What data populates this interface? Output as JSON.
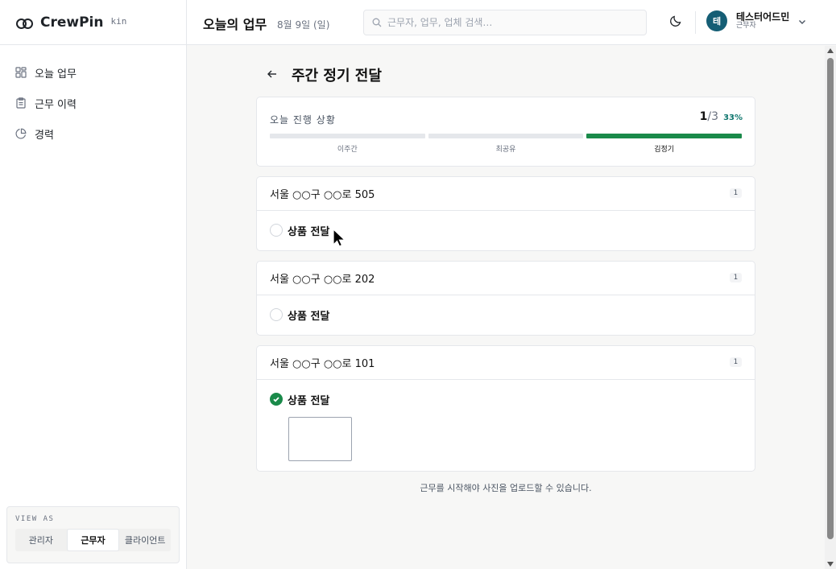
{
  "brand": {
    "name": "CrewPin",
    "sub": "kin"
  },
  "sidebar": {
    "items": [
      {
        "label": "오늘 업무",
        "icon": "grid-icon"
      },
      {
        "label": "근무 이력",
        "icon": "clipboard-icon"
      },
      {
        "label": "경력",
        "icon": "pie-chart-icon"
      }
    ],
    "view_as": {
      "title": "VIEW AS",
      "options": [
        "관리자",
        "근무자",
        "클라이언트"
      ],
      "selected": "근무자"
    }
  },
  "header": {
    "title": "오늘의 업무",
    "date": "8월 9일 (일)",
    "search_placeholder": "근무자, 업무, 업체 검색…",
    "user": {
      "initial": "테",
      "name": "테스터어드민",
      "role": "근무자"
    }
  },
  "main": {
    "section_title": "주간 정기 전달",
    "progress": {
      "label": "오늘 진행 상황",
      "done": "1",
      "separator": "/",
      "total": "3",
      "percent": "33%",
      "steps": [
        {
          "name": "이주간",
          "active": false
        },
        {
          "name": "최공유",
          "active": false
        },
        {
          "name": "김정기",
          "active": true
        }
      ]
    },
    "locations": [
      {
        "address": "서울 ○○구 ○○로 505",
        "count": "1",
        "task": "상품 전달",
        "done": false
      },
      {
        "address": "서울 ○○구 ○○로 202",
        "count": "1",
        "task": "상품 전달",
        "done": false
      },
      {
        "address": "서울 ○○구 ○○로 101",
        "count": "1",
        "task": "상품 전달",
        "done": true
      }
    ],
    "note": "근무를 시작해야 사진을 업로드할 수 있습니다."
  },
  "colors": {
    "accent": "#1a8a4a",
    "avatar": "#155e75",
    "percent": "#0f766e"
  }
}
